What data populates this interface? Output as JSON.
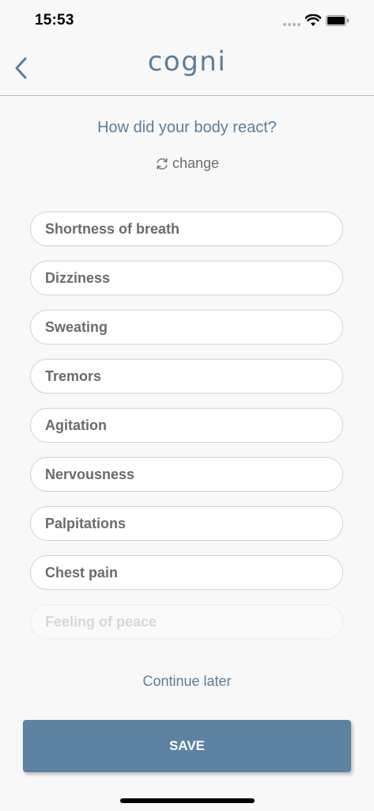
{
  "status_bar": {
    "time": "15:53"
  },
  "header": {
    "logo": "cogni",
    "back_icon": "chevron-left-icon"
  },
  "question": "How did your body react?",
  "change": {
    "icon": "refresh-icon",
    "label": "change"
  },
  "options": [
    {
      "label": "Shortness of breath"
    },
    {
      "label": "Dizziness"
    },
    {
      "label": "Sweating"
    },
    {
      "label": "Tremors"
    },
    {
      "label": "Agitation"
    },
    {
      "label": "Nervousness"
    },
    {
      "label": "Palpitations"
    },
    {
      "label": "Chest pain"
    },
    {
      "label": "Feeling of peace"
    }
  ],
  "continue_later": "Continue later",
  "save_button": "SAVE",
  "colors": {
    "accent": "#5a7f9e",
    "button": "#5e82a1",
    "background": "#f8f8f8"
  }
}
